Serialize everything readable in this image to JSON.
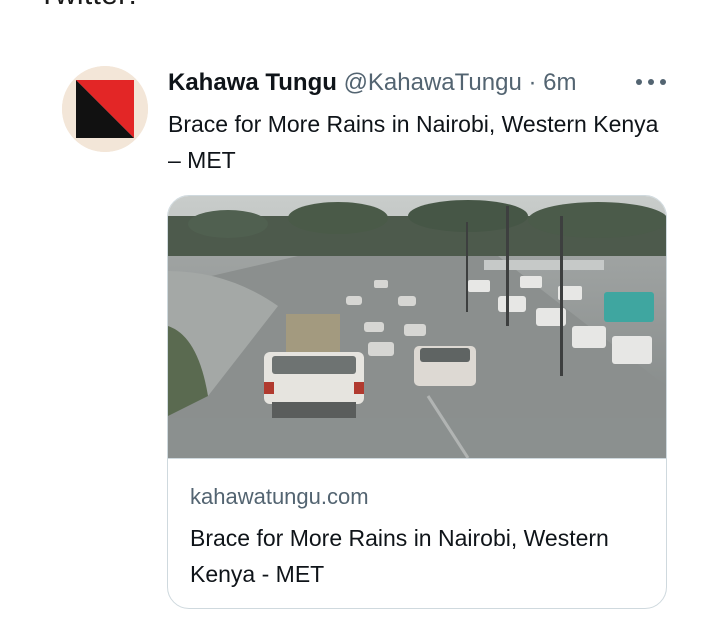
{
  "heading_cut": "Twitter:",
  "tweet": {
    "author": "Kahawa Tungu",
    "handle": "@KahawaTungu",
    "separator": "·",
    "time": "6m",
    "text": "Brace for More Rains in Nairobi, Western Kenya – MET"
  },
  "card": {
    "domain": "kahawatungu.com",
    "title": "Brace for More Rains in Nairobi, Western Kenya - MET",
    "image_alt": "rainy-highway-traffic-photo"
  },
  "icons": {
    "avatar": "kahawa-tungu-logo",
    "more": "more-options-icon"
  },
  "colors": {
    "secondary_text": "#536471",
    "primary_text": "#0f1419",
    "border": "#cfd9de",
    "logo_red": "#e32626",
    "logo_black": "#111111"
  }
}
